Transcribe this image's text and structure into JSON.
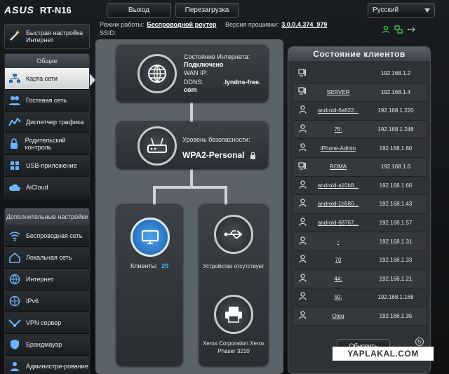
{
  "header": {
    "brand": "ASUS",
    "model": "RT-N16",
    "logout_label": "Выход",
    "reboot_label": "Перезагрузка",
    "language": "Русский",
    "mode_label": "Режим работы:",
    "mode_value": "Беспроводной роутер",
    "firmware_label": "Версия прошивки:",
    "firmware_value": "3.0.0.4.374_979",
    "ssid_label": "SSID:"
  },
  "sidebar": {
    "quick_setup": "Быстрая настройка Интернет",
    "general_title": "Общие",
    "general_items": [
      {
        "label": "Карта сети",
        "icon": "network-map-icon",
        "active": true
      },
      {
        "label": "Гостевая сеть",
        "icon": "guest-network-icon"
      },
      {
        "label": "Диспетчер трафика",
        "icon": "traffic-manager-icon"
      },
      {
        "label": "Родительский контроль",
        "icon": "parental-control-icon"
      },
      {
        "label": "USB-приложение",
        "icon": "usb-app-icon"
      },
      {
        "label": "AiCloud",
        "icon": "aicloud-icon"
      }
    ],
    "advanced_title": "Дополнительные настройки",
    "advanced_items": [
      {
        "label": "Беспроводная сеть",
        "icon": "wireless-icon"
      },
      {
        "label": "Локальная сеть",
        "icon": "lan-icon"
      },
      {
        "label": "Интернет",
        "icon": "internet-icon"
      },
      {
        "label": "IPv6",
        "icon": "ipv6-icon"
      },
      {
        "label": "VPN сервер",
        "icon": "vpn-icon"
      },
      {
        "label": "Брандмауэр",
        "icon": "firewall-icon"
      },
      {
        "label": "Администри-рование",
        "icon": "admin-icon"
      }
    ]
  },
  "map": {
    "internet_status_label": "Состояние Интернета:",
    "internet_status_value": "Подключено",
    "wan_ip_label": "WAN IP:",
    "ddns_label": "DDNS:",
    "ddns_value": ".lyndns-free.",
    "ddns_value2": "com",
    "security_label": "Уровень безопасности:",
    "security_value": "WPA2-Personal",
    "clients_label": "Клиенты:",
    "clients_count": "20",
    "usb_status": "Устройство отсутствует",
    "printer_name": "Xerox Corporation Xerox Phaser 3210"
  },
  "clients_panel": {
    "title": "Состояние клиентов",
    "refresh_label": "Обновить",
    "rows": [
      {
        "type": "pc",
        "name": "",
        "ip": "192.168.1.2"
      },
      {
        "type": "pc",
        "name": "SERVER",
        "ip": "192.168.1.4"
      },
      {
        "type": "user",
        "name": "android-6a622...",
        "ip": "192.168.1.220"
      },
      {
        "type": "user",
        "name": "76:",
        "ip": "192.168.1.248"
      },
      {
        "type": "user",
        "name": "iPhone-Admin",
        "ip": "192.168.1.60"
      },
      {
        "type": "pc",
        "name": "ROMA",
        "ip": "192.168.1.6"
      },
      {
        "type": "user",
        "name": "android-a10b8...",
        "ip": "192.168.1.66"
      },
      {
        "type": "user",
        "name": "android-1b580...",
        "ip": "192.168.1.43"
      },
      {
        "type": "user",
        "name": "android-68767...",
        "ip": "192.168.1.57"
      },
      {
        "type": "user",
        "name": "-",
        "ip": "192.168.1.31"
      },
      {
        "type": "user",
        "name": "70",
        "ip": "192.168.1.33"
      },
      {
        "type": "user",
        "name": "44:",
        "ip": "192.168.1.21"
      },
      {
        "type": "user",
        "name": "50:",
        "ip": "192.168.1.168"
      },
      {
        "type": "user",
        "name": "Oleg",
        "ip": "192.168.1.35"
      }
    ]
  },
  "watermark": "YAPLAKAL.COM",
  "colors": {
    "accent": "#2b6fb3",
    "status_green": "#39d353"
  }
}
